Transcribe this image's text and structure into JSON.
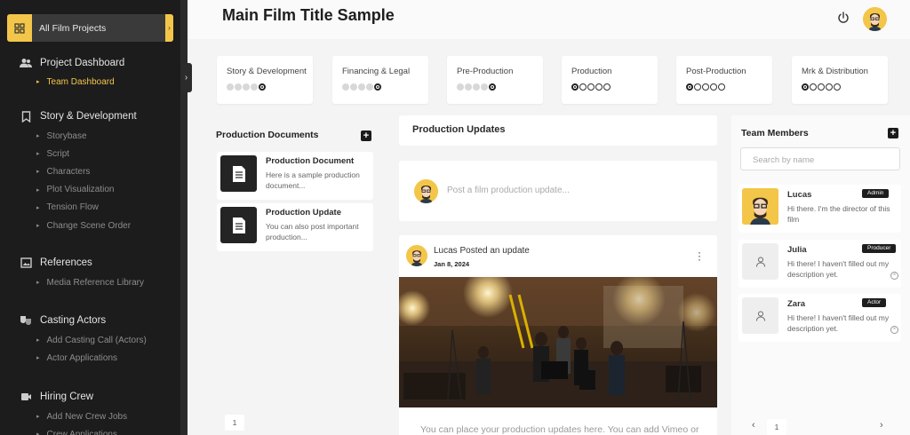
{
  "sidebar": {
    "project_button": "All Film Projects",
    "sections": [
      {
        "title": "Project Dashboard",
        "icon": "people-icon",
        "items": [
          {
            "label": "Team Dashboard",
            "active": true
          }
        ]
      },
      {
        "title": "Story & Development",
        "icon": "bookmark-icon",
        "items": [
          {
            "label": "Storybase"
          },
          {
            "label": "Script"
          },
          {
            "label": "Characters"
          },
          {
            "label": "Plot Visualization"
          },
          {
            "label": "Tension Flow"
          },
          {
            "label": "Change Scene Order"
          }
        ]
      },
      {
        "title": "References",
        "icon": "image-icon",
        "items": [
          {
            "label": "Media Reference Library"
          }
        ]
      },
      {
        "title": "Casting Actors",
        "icon": "theater-masks-icon",
        "items": [
          {
            "label": "Add Casting Call (Actors)"
          },
          {
            "label": "Actor Applications"
          }
        ]
      },
      {
        "title": "Hiring Crew",
        "icon": "film-icon",
        "items": [
          {
            "label": "Add New Crew Jobs"
          },
          {
            "label": "Crew Applications"
          }
        ]
      }
    ]
  },
  "header": {
    "title": "Main Film Title Sample"
  },
  "stages": [
    {
      "label": "Story & Development",
      "state": "complete"
    },
    {
      "label": "Financing & Legal",
      "state": "complete"
    },
    {
      "label": "Pre-Production",
      "state": "complete"
    },
    {
      "label": "Production",
      "state": "pending"
    },
    {
      "label": "Post-Production",
      "state": "pending"
    },
    {
      "label": "Mrk & Distribution",
      "state": "pending"
    }
  ],
  "documents": {
    "title": "Production Documents",
    "items": [
      {
        "title": "Production Document",
        "desc": "Here is a sample production document..."
      },
      {
        "title": "Production Update",
        "desc": "You can also post important production..."
      }
    ],
    "page": "1"
  },
  "updates": {
    "title": "Production Updates",
    "placeholder": "Post a film production update...",
    "post": {
      "author_line": "Lucas Posted an update",
      "date": "Jan 8, 2024",
      "caption": "You can place your production updates here. You can add Vimeo or"
    }
  },
  "team": {
    "title": "Team Members",
    "search_placeholder": "Search by name",
    "members": [
      {
        "name": "Lucas",
        "role": "Admin",
        "desc": "Hi there. I'm the director of this film"
      },
      {
        "name": "Julia",
        "role": "Producer",
        "desc": "Hi there! I haven't filled out my description yet."
      },
      {
        "name": "Zara",
        "role": "Actor",
        "desc": "Hi there! I haven't filled out my description yet."
      }
    ],
    "page": "1",
    "prev": "‹",
    "next": "›"
  },
  "colors": {
    "accent": "#f3c64a",
    "sidebar": "#1c1c1c",
    "dark": "#1e1e1e"
  }
}
